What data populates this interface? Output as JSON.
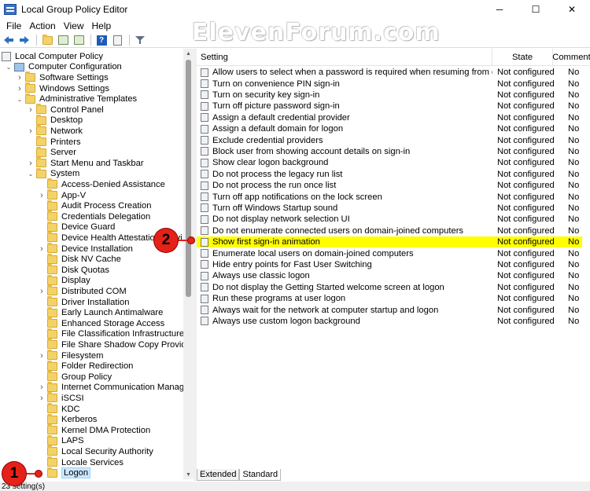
{
  "window": {
    "title": "Local Group Policy Editor",
    "minimize": "─",
    "maximize": "☐",
    "close": "✕"
  },
  "watermark": "ElevenForum.com",
  "menu": [
    "File",
    "Action",
    "View",
    "Help"
  ],
  "toolbar": {
    "icons": [
      "back-arrow-icon",
      "forward-arrow-icon",
      "up-folder-icon",
      "show-hide-tree-icon",
      "export-list-icon",
      "help-icon",
      "properties-icon",
      "filter-icon"
    ]
  },
  "tree": [
    {
      "label": "Local Computer Policy",
      "depth": 0,
      "expander": "",
      "icon": "policy"
    },
    {
      "label": "Computer Configuration",
      "depth": 1,
      "expander": "open",
      "icon": "pc"
    },
    {
      "label": "Software Settings",
      "depth": 2,
      "expander": "closed",
      "icon": "folder"
    },
    {
      "label": "Windows Settings",
      "depth": 2,
      "expander": "closed",
      "icon": "folder"
    },
    {
      "label": "Administrative Templates",
      "depth": 2,
      "expander": "open",
      "icon": "folder"
    },
    {
      "label": "Control Panel",
      "depth": 3,
      "expander": "closed",
      "icon": "folder"
    },
    {
      "label": "Desktop",
      "depth": 3,
      "expander": "",
      "icon": "folder"
    },
    {
      "label": "Network",
      "depth": 3,
      "expander": "closed",
      "icon": "folder"
    },
    {
      "label": "Printers",
      "depth": 3,
      "expander": "",
      "icon": "folder"
    },
    {
      "label": "Server",
      "depth": 3,
      "expander": "",
      "icon": "folder"
    },
    {
      "label": "Start Menu and Taskbar",
      "depth": 3,
      "expander": "closed",
      "icon": "folder"
    },
    {
      "label": "System",
      "depth": 3,
      "expander": "open",
      "icon": "folder"
    },
    {
      "label": "Access-Denied Assistance",
      "depth": 4,
      "expander": "",
      "icon": "folder"
    },
    {
      "label": "App-V",
      "depth": 4,
      "expander": "closed",
      "icon": "folder"
    },
    {
      "label": "Audit Process Creation",
      "depth": 4,
      "expander": "",
      "icon": "folder"
    },
    {
      "label": "Credentials Delegation",
      "depth": 4,
      "expander": "",
      "icon": "folder"
    },
    {
      "label": "Device Guard",
      "depth": 4,
      "expander": "",
      "icon": "folder"
    },
    {
      "label": "Device Health Attestation Servi",
      "depth": 4,
      "expander": "",
      "icon": "folder"
    },
    {
      "label": "Device Installation",
      "depth": 4,
      "expander": "closed",
      "icon": "folder"
    },
    {
      "label": "Disk NV Cache",
      "depth": 4,
      "expander": "",
      "icon": "folder"
    },
    {
      "label": "Disk Quotas",
      "depth": 4,
      "expander": "",
      "icon": "folder"
    },
    {
      "label": "Display",
      "depth": 4,
      "expander": "",
      "icon": "folder"
    },
    {
      "label": "Distributed COM",
      "depth": 4,
      "expander": "closed",
      "icon": "folder"
    },
    {
      "label": "Driver Installation",
      "depth": 4,
      "expander": "",
      "icon": "folder"
    },
    {
      "label": "Early Launch Antimalware",
      "depth": 4,
      "expander": "",
      "icon": "folder"
    },
    {
      "label": "Enhanced Storage Access",
      "depth": 4,
      "expander": "",
      "icon": "folder"
    },
    {
      "label": "File Classification Infrastructure",
      "depth": 4,
      "expander": "",
      "icon": "folder"
    },
    {
      "label": "File Share Shadow Copy Provider",
      "depth": 4,
      "expander": "",
      "icon": "folder"
    },
    {
      "label": "Filesystem",
      "depth": 4,
      "expander": "closed",
      "icon": "folder"
    },
    {
      "label": "Folder Redirection",
      "depth": 4,
      "expander": "",
      "icon": "folder"
    },
    {
      "label": "Group Policy",
      "depth": 4,
      "expander": "",
      "icon": "folder"
    },
    {
      "label": "Internet Communication Management",
      "depth": 4,
      "expander": "closed",
      "icon": "folder"
    },
    {
      "label": "iSCSI",
      "depth": 4,
      "expander": "closed",
      "icon": "folder"
    },
    {
      "label": "KDC",
      "depth": 4,
      "expander": "",
      "icon": "folder"
    },
    {
      "label": "Kerberos",
      "depth": 4,
      "expander": "",
      "icon": "folder"
    },
    {
      "label": "Kernel DMA Protection",
      "depth": 4,
      "expander": "",
      "icon": "folder"
    },
    {
      "label": "LAPS",
      "depth": 4,
      "expander": "",
      "icon": "folder"
    },
    {
      "label": "Local Security Authority",
      "depth": 4,
      "expander": "",
      "icon": "folder"
    },
    {
      "label": "Locale Services",
      "depth": 4,
      "expander": "",
      "icon": "folder"
    },
    {
      "label": "Logon",
      "depth": 4,
      "expander": "",
      "icon": "folder",
      "selected": true
    }
  ],
  "columns": {
    "setting": "Setting",
    "state": "State",
    "comment": "Comment"
  },
  "settings": [
    {
      "name": "Allow users to select when a password is required when resuming from connected standby",
      "state": "Not configured",
      "comment": "No"
    },
    {
      "name": "Turn on convenience PIN sign-in",
      "state": "Not configured",
      "comment": "No"
    },
    {
      "name": "Turn on security key sign-in",
      "state": "Not configured",
      "comment": "No"
    },
    {
      "name": "Turn off picture password sign-in",
      "state": "Not configured",
      "comment": "No"
    },
    {
      "name": "Assign a default credential provider",
      "state": "Not configured",
      "comment": "No"
    },
    {
      "name": "Assign a default domain for logon",
      "state": "Not configured",
      "comment": "No"
    },
    {
      "name": "Exclude credential providers",
      "state": "Not configured",
      "comment": "No"
    },
    {
      "name": "Block user from showing account details on sign-in",
      "state": "Not configured",
      "comment": "No"
    },
    {
      "name": "Show clear logon background",
      "state": "Not configured",
      "comment": "No"
    },
    {
      "name": "Do not process the legacy run list",
      "state": "Not configured",
      "comment": "No"
    },
    {
      "name": "Do not process the run once list",
      "state": "Not configured",
      "comment": "No"
    },
    {
      "name": "Turn off app notifications on the lock screen",
      "state": "Not configured",
      "comment": "No"
    },
    {
      "name": "Turn off Windows Startup sound",
      "state": "Not configured",
      "comment": "No"
    },
    {
      "name": "Do not display network selection UI",
      "state": "Not configured",
      "comment": "No"
    },
    {
      "name": "Do not enumerate connected users on domain-joined computers",
      "state": "Not configured",
      "comment": "No"
    },
    {
      "name": "Show first sign-in animation",
      "state": "Not configured",
      "comment": "No",
      "highlighted": true
    },
    {
      "name": "Enumerate local users on domain-joined computers",
      "state": "Not configured",
      "comment": "No"
    },
    {
      "name": "Hide entry points for Fast User Switching",
      "state": "Not configured",
      "comment": "No"
    },
    {
      "name": "Always use classic logon",
      "state": "Not configured",
      "comment": "No"
    },
    {
      "name": "Do not display the Getting Started welcome screen at logon",
      "state": "Not configured",
      "comment": "No"
    },
    {
      "name": "Run these programs at user logon",
      "state": "Not configured",
      "comment": "No"
    },
    {
      "name": "Always wait for the network at computer startup and logon",
      "state": "Not configured",
      "comment": "No"
    },
    {
      "name": "Always use custom logon background",
      "state": "Not configured",
      "comment": "No"
    }
  ],
  "tabs": [
    "Extended",
    "Standard"
  ],
  "active_tab": "Standard",
  "status": "23 setting(s)",
  "callouts": [
    "1",
    "2"
  ],
  "colors": {
    "highlight": "#ffff00",
    "callout": "#e52218",
    "selection": "#cce8ff"
  }
}
